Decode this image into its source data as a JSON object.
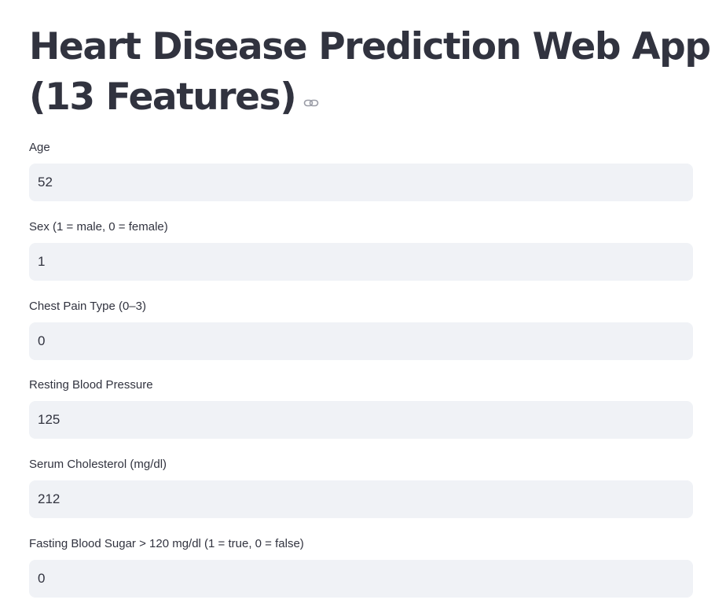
{
  "page": {
    "title_line1": "Heart Disease Prediction Web App",
    "title_line2": "(13 Features)",
    "title_link_icon": "link-icon"
  },
  "fields": [
    {
      "label": "Age",
      "value": "52"
    },
    {
      "label": "Sex (1 = male, 0 = female)",
      "value": "1"
    },
    {
      "label": "Chest Pain Type (0–3)",
      "value": "0"
    },
    {
      "label": "Resting Blood Pressure",
      "value": "125"
    },
    {
      "label": "Serum Cholesterol (mg/dl)",
      "value": "212"
    },
    {
      "label": "Fasting Blood Sugar > 120 mg/dl (1 = true, 0 = false)",
      "value": "0"
    }
  ],
  "colors": {
    "text": "#31333f",
    "input_background": "#f0f2f6",
    "icon": "#9a9ca6"
  }
}
